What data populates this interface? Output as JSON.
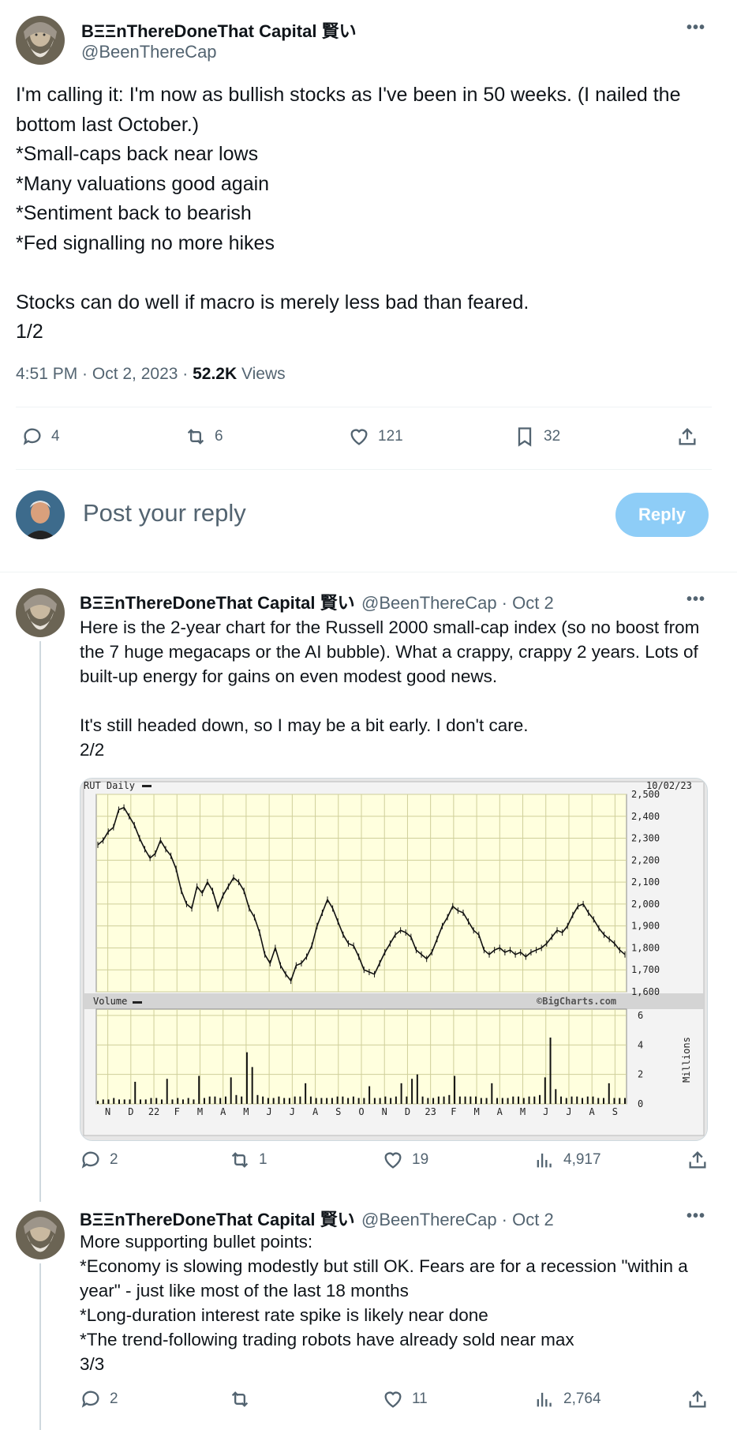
{
  "main_tweet": {
    "author_name": "BΞΞnThereDoneThat Capital 賢い",
    "handle": "@BeenThereCap",
    "text": "I'm calling it: I'm now as bullish stocks as I've been in 50 weeks. (I nailed the bottom last October.)\n*Small-caps back near lows\n*Many valuations good again\n*Sentiment back to bearish\n*Fed signalling no more hikes\n\nStocks can do well if macro is merely less bad than feared.\n1/2",
    "time": "4:51 PM · Oct 2, 2023 · ",
    "views_count": "52.2K",
    "views_label": " Views",
    "replies": "4",
    "reposts": "6",
    "likes": "121",
    "bookmarks": "32"
  },
  "composer": {
    "placeholder": "Post your reply",
    "reply_label": "Reply"
  },
  "reply1": {
    "author_name": "BΞΞnThereDoneThat Capital 賢い",
    "handle_date": "@BeenThereCap · Oct 2",
    "text": "Here is the 2-year chart for the Russell 2000 small-cap index (so no boost from the 7 huge megacaps or the AI bubble). What a crappy, crappy 2 years. Lots of built-up energy for gains on even modest good news.\n\nIt's still headed down, so I may be a bit early. I don't care.\n2/2",
    "replies": "2",
    "reposts": "1",
    "likes": "19",
    "views": "4,917"
  },
  "reply2": {
    "author_name": "BΞΞnThereDoneThat Capital 賢い",
    "handle_date": "@BeenThereCap · Oct 2",
    "text": "More supporting bullet points:\n*Economy is slowing modestly but still OK. Fears are for a recession \"within a year\" - just like most of the last 18 months\n*Long-duration interest rate spike is likely near done\n*The trend-following trading robots have already sold near max\n3/3",
    "replies": "2",
    "reposts": "",
    "likes": "11",
    "views": "2,764"
  },
  "chart_data": {
    "type": "line",
    "title": "RUT Daily",
    "date_label": "10/02/23",
    "watermark": "©BigCharts.com",
    "volume_title": "Volume",
    "volume_unit": "Millions",
    "x_tick_labels": [
      "N",
      "D",
      "22",
      "F",
      "M",
      "A",
      "M",
      "J",
      "J",
      "A",
      "S",
      "O",
      "N",
      "D",
      "23",
      "F",
      "M",
      "A",
      "M",
      "J",
      "J",
      "A",
      "S"
    ],
    "y_tick_labels": [
      "2,500",
      "2,400",
      "2,300",
      "2,200",
      "2,100",
      "2,000",
      "1,900",
      "1,800",
      "1,700",
      "1,600"
    ],
    "ylim": [
      1600,
      2500
    ],
    "volume_tick_labels": [
      "6",
      "4",
      "2",
      "0"
    ],
    "volume_ylim": [
      0,
      6
    ],
    "series": [
      {
        "values": [
          2270,
          2290,
          2330,
          2350,
          2430,
          2440,
          2400,
          2360,
          2300,
          2250,
          2210,
          2230,
          2290,
          2250,
          2220,
          2160,
          2060,
          2000,
          1980,
          2080,
          2050,
          2100,
          2060,
          1980,
          2040,
          2080,
          2120,
          2100,
          2060,
          1980,
          1940,
          1870,
          1770,
          1730,
          1800,
          1720,
          1680,
          1650,
          1720,
          1730,
          1760,
          1810,
          1900,
          1960,
          2020,
          1980,
          1920,
          1860,
          1820,
          1810,
          1760,
          1700,
          1690,
          1680,
          1730,
          1780,
          1820,
          1860,
          1880,
          1870,
          1850,
          1790,
          1770,
          1750,
          1780,
          1840,
          1900,
          1940,
          1990,
          1970,
          1960,
          1920,
          1880,
          1860,
          1790,
          1770,
          1790,
          1800,
          1780,
          1790,
          1770,
          1780,
          1760,
          1780,
          1790,
          1800,
          1820,
          1850,
          1880,
          1870,
          1900,
          1950,
          1990,
          2000,
          1960,
          1930,
          1890,
          1860,
          1840,
          1820,
          1790,
          1770
        ]
      }
    ],
    "volume_values": [
      0.2,
      0.3,
      0.3,
      0.4,
      0.3,
      0.3,
      0.3,
      1.5,
      0.3,
      0.3,
      0.4,
      0.4,
      0.3,
      1.7,
      0.3,
      0.4,
      0.3,
      0.4,
      0.3,
      1.9,
      0.4,
      0.5,
      0.5,
      0.4,
      0.5,
      1.8,
      0.6,
      0.5,
      3.5,
      2.5,
      0.6,
      0.5,
      0.4,
      0.4,
      0.5,
      0.4,
      0.4,
      0.5,
      0.5,
      1.4,
      0.5,
      0.4,
      0.4,
      0.4,
      0.4,
      0.5,
      0.5,
      0.4,
      0.5,
      0.4,
      0.4,
      1.2,
      0.4,
      0.4,
      0.5,
      0.4,
      0.5,
      1.4,
      0.5,
      1.7,
      2.0,
      0.5,
      0.4,
      0.4,
      0.5,
      0.5,
      0.6,
      1.9,
      0.5,
      0.5,
      0.5,
      0.5,
      0.4,
      0.4,
      1.4,
      0.4,
      0.4,
      0.4,
      0.5,
      0.5,
      0.4,
      0.5,
      0.5,
      0.6,
      1.8,
      4.5,
      1.0,
      0.5,
      0.4,
      0.5,
      0.5,
      0.4,
      0.5,
      0.5,
      0.4,
      0.4,
      1.4,
      0.4,
      0.4,
      0.4
    ],
    "grid": true
  }
}
